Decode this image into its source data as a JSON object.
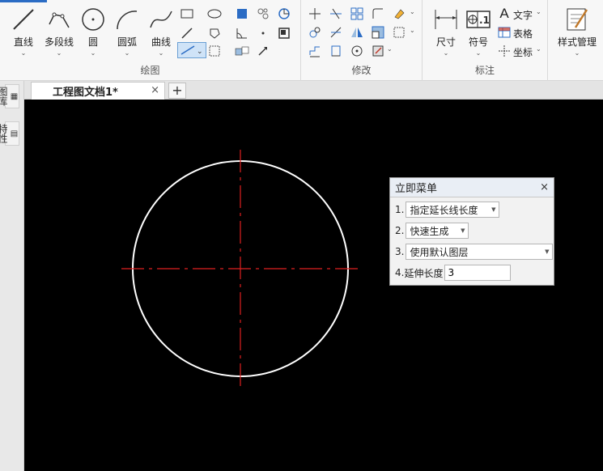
{
  "ribbon": {
    "groups": {
      "draw": "绘图",
      "modify": "修改",
      "annotate": "标注",
      "style": "样式管理"
    },
    "draw_buttons": {
      "line": "直线",
      "polyline": "多段线",
      "circle": "圆",
      "arc": "圆弧",
      "curve": "曲线"
    },
    "annotate_buttons": {
      "dimension": "尺寸",
      "symbol": "符号",
      "text": "文字",
      "table": "表格",
      "coordinate": "坐标"
    },
    "symbol_glyph": "⊕.1"
  },
  "sidebar": {
    "tab1": "图库",
    "tab2": "特性"
  },
  "tabs": {
    "doc_title": "工程图文档1*",
    "close": "×",
    "add": "+"
  },
  "immediate_menu": {
    "title": "立即菜单",
    "close": "×",
    "rows": [
      {
        "num": "1.",
        "value": "指定延长线长度"
      },
      {
        "num": "2.",
        "value": "快速生成"
      },
      {
        "num": "3.",
        "value": "使用默认图层"
      },
      {
        "num": "4.",
        "label": "延伸长度",
        "value": "3"
      }
    ]
  },
  "colors": {
    "canvas_bg": "#000000",
    "circle_stroke": "#ffffff",
    "centerline": "#e02020",
    "accent": "#2b6cc4"
  }
}
